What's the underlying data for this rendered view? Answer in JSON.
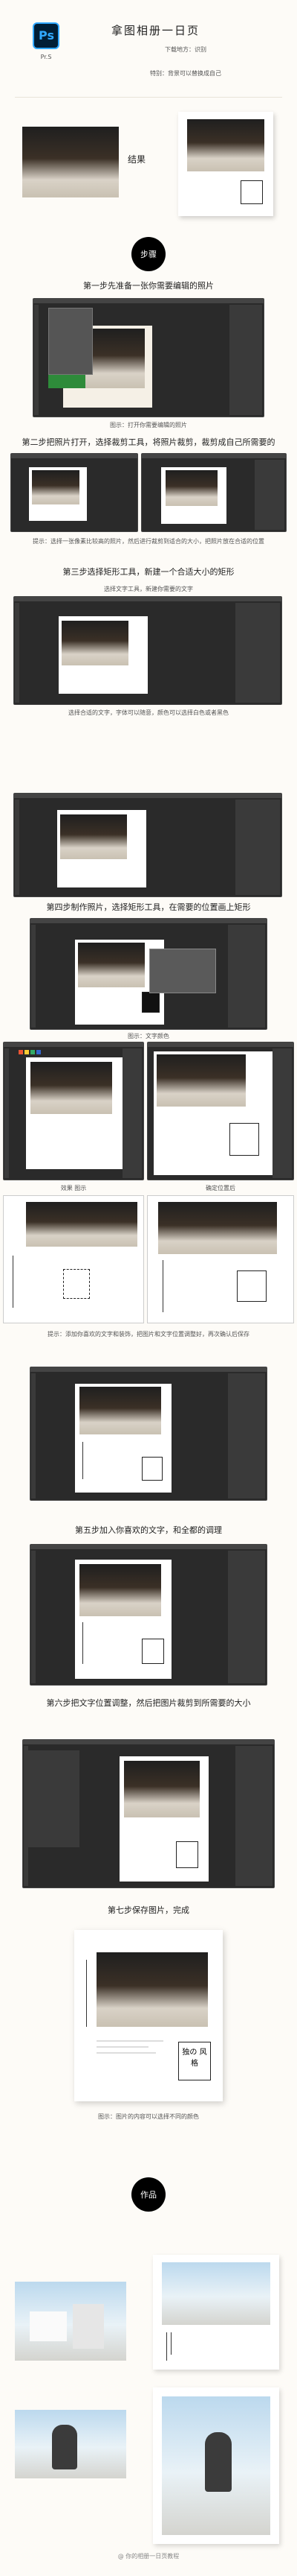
{
  "header": {
    "app_logo_text": "Ps",
    "app_name": "Pr.S",
    "title": "拿图相册一日页",
    "subtitle": "下载地方：识别",
    "tip": "特别：背景可以替换成自己"
  },
  "intro": {
    "example_label": "结果"
  },
  "section_step": {
    "label": "步骤"
  },
  "steps": [
    "第一步先准备一张你需要编辑的照片",
    "第二步把照片打开，选择裁剪工具，将照片裁剪，裁剪成自己所需要的",
    "第三步选择矩形工具，新建一个合适大小的矩形",
    "第四步制作照片，选择矩形工具，在需要的位置画上矩形",
    "第五步加入你喜欢的文字，和全都的调理",
    "第六步把文字位置调整，然后把图片裁剪到所需要的大小",
    "第七步保存图片，完成"
  ],
  "captions": [
    "图示：打开你需要编辑的照片",
    "提示：选择一张像素比较高的照片，然后进行裁剪到适合的大小，把照片放在合适的位置",
    "选择文字工具，新建你需要的文字",
    "选择合适的文字，字体可以随意，颜色可以选择白色或者黑色",
    "图示：文字颜色",
    "效果 图示",
    "确定位置后",
    "图示：画面",
    "图示：点击调整",
    "提示：添加你喜欢的文字和装饰，把图片和文字位置调整好，再次确认后保存",
    "图示：图片的内容可以选择不同的颜色"
  ],
  "result_card": {
    "card_text": "独の 风格"
  },
  "section_works": {
    "label": "作品"
  },
  "footer": {
    "watermark": "@ 你的相册一日页教程"
  },
  "colors": {
    "accent": "#000000",
    "ps_blue": "#31a8ff",
    "ps_dark": "#001e36",
    "background": "#fdfbf7"
  }
}
